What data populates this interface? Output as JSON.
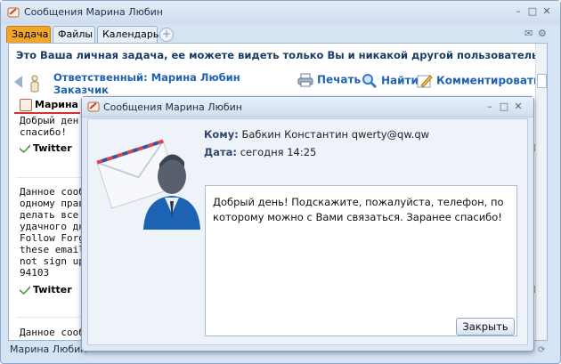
{
  "window": {
    "title": "Сообщения Марина Любин"
  },
  "tabs": [
    {
      "label": "Задача"
    },
    {
      "label": "Файлы"
    },
    {
      "label": "Календарь"
    }
  ],
  "notice": "Это Ваша личная задача, ее можете видеть только Вы и никакой другой пользователь",
  "task": {
    "responsible": "Ответственный: Марина Любин",
    "customer": "Заказчик"
  },
  "toolbar": {
    "print": "Печать",
    "find": "Найти",
    "comment": "Комментировать"
  },
  "messages": {
    "m1_name": "Марина Л",
    "m1_line1": "Добрый ден",
    "m1_line2": "спасибо!",
    "twitter": "Twitter",
    "m2_lines": [
      "Данное сооб",
      "одному прав",
      "делать все х",
      "удачного дн",
      "Follow Forgo",
      "these emails",
      "not sign up f",
      "94103"
    ],
    "m2_right": "d",
    "m3_line": "Данное сооб"
  },
  "status": "Марина Любин",
  "dialog": {
    "title": "Сообщения Марина Любин",
    "to_label": "Кому:",
    "to_value": "Бабкин Константин qwerty@qw.qw",
    "date_label": "Дата:",
    "date_value": "сегодня 14:25",
    "message": "Добрый день! Подскажите, пожалуйста, телефон, по которому можно с Вами  связаться. Заранее спасибо!",
    "close_label": "Закрыть"
  }
}
